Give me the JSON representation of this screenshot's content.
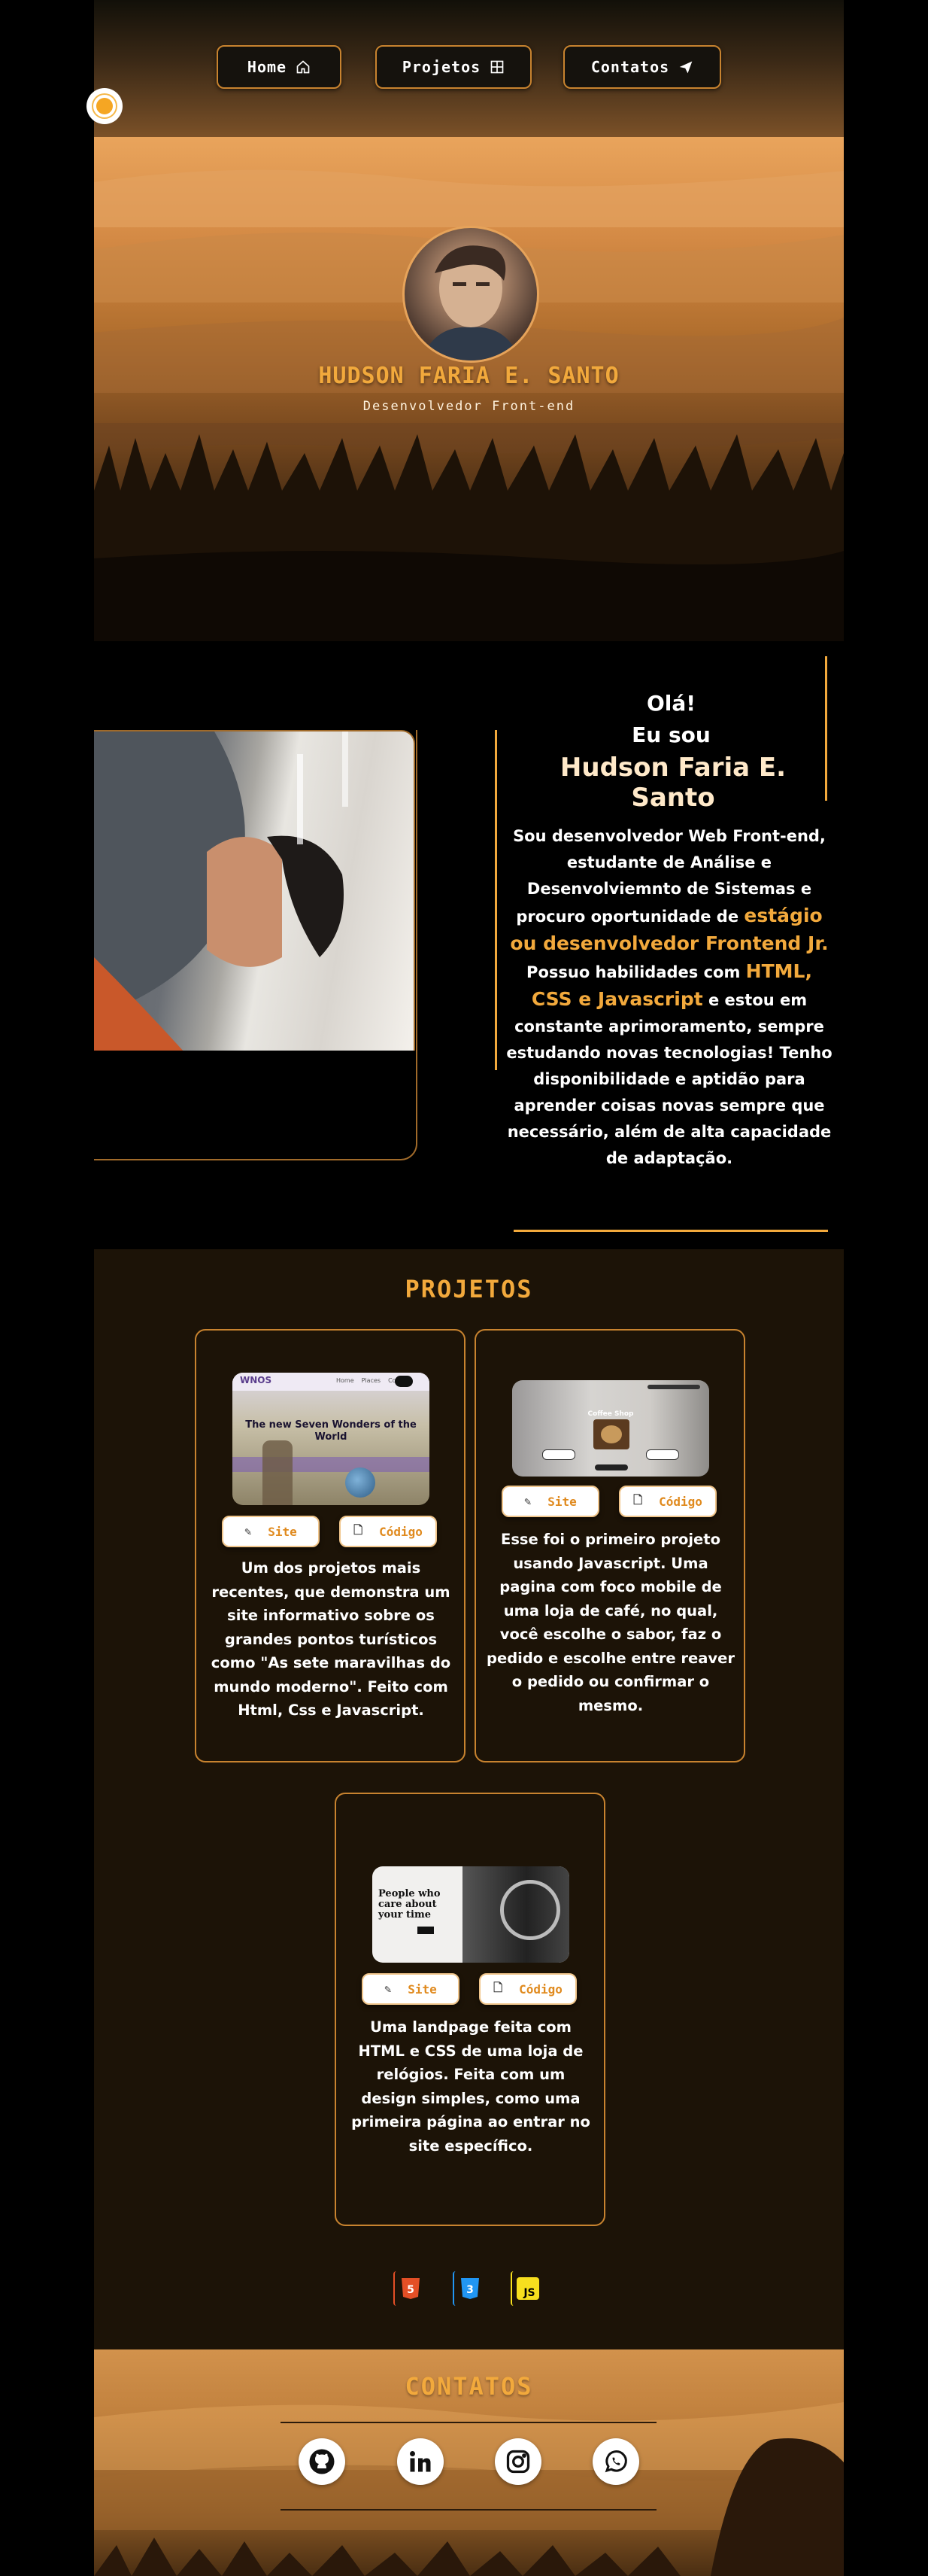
{
  "nav": {
    "items": [
      {
        "label": "Home",
        "icon": "home-icon"
      },
      {
        "label": "Projetos",
        "icon": "grid-icon"
      },
      {
        "label": "Contatos",
        "icon": "send-icon"
      }
    ]
  },
  "theme_toggle": {
    "icon": "sun-icon"
  },
  "hero": {
    "name": "HUDSON FARIA E. SANTO",
    "role": "Desenvolvedor Front-end"
  },
  "about": {
    "greeting": "Olá!",
    "intro": "Eu sou",
    "full_name": "Hudson Faria E. Santo",
    "bio": {
      "p1": "Sou desenvolvedor Web Front-end, estudante de Análise e Desenvolviemnto de Sistemas e procuro oportunidade de",
      "hl1": "estágio ou desenvolvedor Frontend Jr.",
      "p2": "Possuo habilidades com",
      "hl2": "HTML, CSS e Javascript",
      "p3": "e estou em constante aprimoramento, sempre estudando novas tecnologias! Tenho disponibilidade e aptidão para aprender coisas novas sempre que necessário, além de alta capacidade de adaptação."
    }
  },
  "projects": {
    "title": "PROJETOS",
    "site_label": "Site",
    "code_label": "Código",
    "items": [
      {
        "thumb_brand": "WNOS",
        "thumb_nav": [
          "Home",
          "Places",
          "Contact"
        ],
        "thumb_heading": "The new Seven Wonders of the World",
        "description": "Um dos projetos mais recentes, que demonstra um site informativo sobre os grandes pontos turísticos como \"As sete maravilhas do mundo moderno\". Feito com Html, Css e Javascript."
      },
      {
        "thumb_heading": "Coffee Shop",
        "description": "Esse foi o primeiro projeto usando Javascript. Uma pagina com foco mobile de uma loja de café, no qual, você escolhe o sabor, faz o pedido e escolhe entre reaver o pedido ou confirmar o mesmo."
      },
      {
        "thumb_heading": "People who care about your time",
        "description": "Uma landpage feita com HTML e CSS de uma loja de relógios. Feita com um design simples, como uma primeira página ao entrar no site específico."
      }
    ],
    "tech_icons": [
      {
        "name": "html5-icon",
        "label": "5",
        "color": "#e34f26"
      },
      {
        "name": "css3-icon",
        "label": "3",
        "color": "#2196f3"
      },
      {
        "name": "js-icon",
        "label": "JS",
        "color": "#f7df1e"
      }
    ]
  },
  "contacts": {
    "title": "CONTATOS",
    "links": [
      "github-icon",
      "linkedin-icon",
      "instagram-icon",
      "whatsapp-icon"
    ]
  },
  "colors": {
    "accent": "#f2a93c",
    "border": "#c8832f",
    "bg_dark": "#1c1307"
  }
}
